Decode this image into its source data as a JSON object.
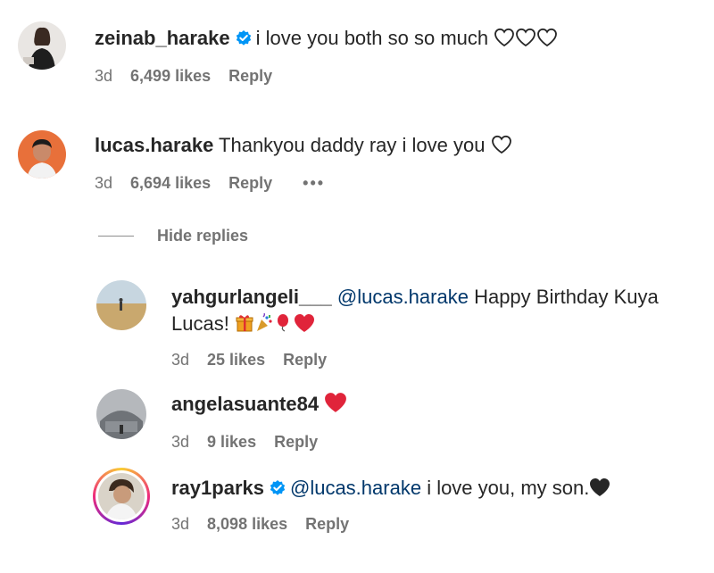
{
  "comments": [
    {
      "username": "zeinab_harake",
      "verified": true,
      "text": "i love you both so so much",
      "time": "3d",
      "likes": "6,499 likes",
      "reply": "Reply"
    },
    {
      "username": "lucas.harake",
      "verified": false,
      "text": "Thankyou daddy ray i love you",
      "time": "3d",
      "likes": "6,694 likes",
      "reply": "Reply",
      "more": "•••"
    }
  ],
  "thread": {
    "hide_replies_label": "Hide replies"
  },
  "replies": [
    {
      "username": "yahgurlangeli___",
      "mention": "@lucas.harake",
      "text": "Happy Birthday Kuya Lucas!",
      "time": "3d",
      "likes": "25 likes",
      "reply": "Reply"
    },
    {
      "username": "angelasuante84",
      "time": "3d",
      "likes": "9 likes",
      "reply": "Reply"
    },
    {
      "username": "ray1parks",
      "verified": true,
      "mention": "@lucas.harake",
      "text": "i love you, my son.",
      "time": "3d",
      "likes": "8,098 likes",
      "reply": "Reply"
    }
  ],
  "colors": {
    "username": "#262626",
    "meta": "#737373",
    "mention": "#00376b",
    "verified": "#0095f6",
    "red_heart": "#e0243a",
    "black_heart": "#262626"
  },
  "icons": [
    "verified-badge-icon",
    "heart-outline-icon",
    "gift-icon",
    "party-popper-icon",
    "balloon-icon",
    "red-heart-icon",
    "black-heart-icon",
    "more-options-icon"
  ]
}
